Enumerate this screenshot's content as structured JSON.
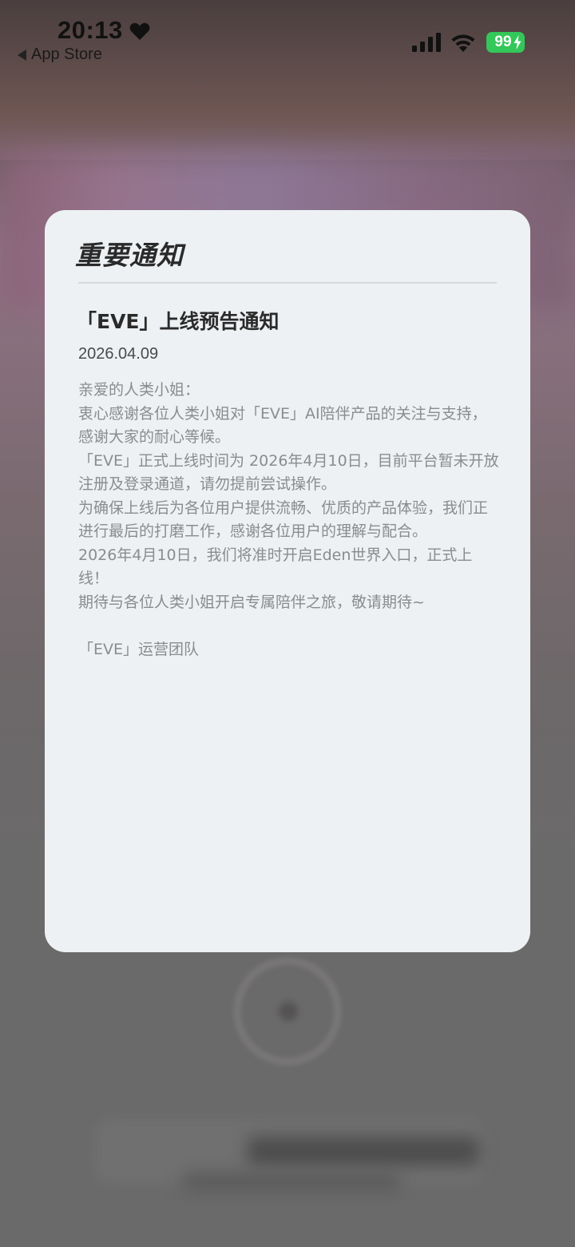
{
  "status_bar": {
    "time": "20:13",
    "back_label": "App Store",
    "battery": "99",
    "colors": {
      "battery_fill": "#34c759"
    },
    "icons": [
      "heart-icon",
      "signal-icon",
      "wifi-icon",
      "bolt-icon"
    ]
  },
  "modal": {
    "heading": "重要通知",
    "notice": {
      "title": "「EVE」上线预告通知",
      "date": "2026.04.09",
      "greeting": "亲爱的人类小姐：",
      "lines": [
        "衷心感谢各位人类小姐对「EVE」AI陪伴产品的关注与支持，感谢大家的耐心等候。",
        "「EVE」正式上线时间为 2026年4月10日，目前平台暂未开放注册及登录通道，请勿提前尝试操作。",
        "为确保上线后为各位用户提供流畅、优质的产品体验，我们正进行最后的打磨工作，感谢各位用户的理解与配合。",
        "2026年4月10日，我们将准时开启Eden世界入口，正式上线！",
        "期待与各位人类小姐开启专属陪伴之旅，敬请期待~"
      ],
      "signature": "「EVE」运营团队"
    }
  }
}
